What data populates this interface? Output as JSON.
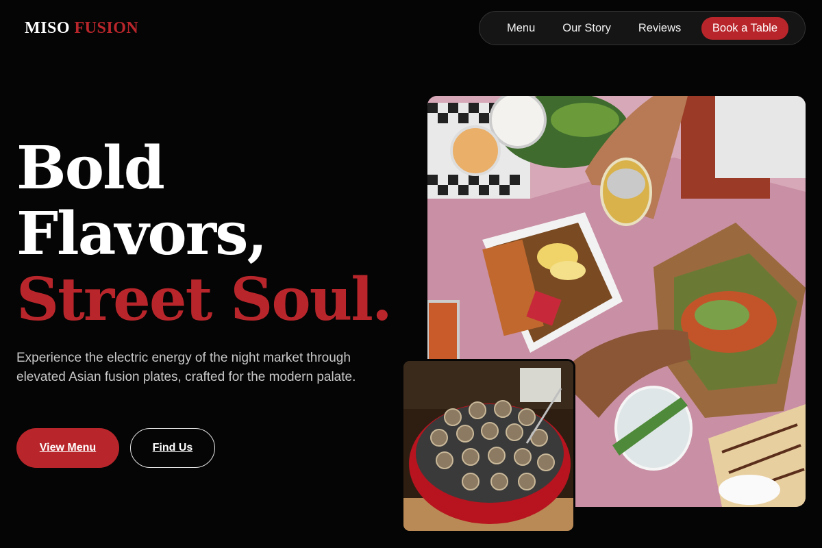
{
  "brand": {
    "name_part1": "MISO",
    "name_part2": "FUSION",
    "accent_color": "#b8262b"
  },
  "nav": {
    "items": [
      {
        "label": "Menu"
      },
      {
        "label": "Our Story"
      },
      {
        "label": "Reviews"
      }
    ],
    "cta_label": "Book a Table"
  },
  "hero": {
    "headline_line1": "Bold",
    "headline_line2": "Flavors,",
    "headline_line3": "Street Soul.",
    "description": "Experience the electric energy of the night market through elevated Asian fusion plates, crafted for the modern palate.",
    "primary_button": "View Menu",
    "secondary_button": "Find Us"
  },
  "images": {
    "main_subject": "street-food-spread-photo",
    "small_subject": "takoyaki-pan-photo"
  },
  "colors": {
    "background": "#050505",
    "accent": "#b8262b",
    "nav_bg": "#151515"
  }
}
